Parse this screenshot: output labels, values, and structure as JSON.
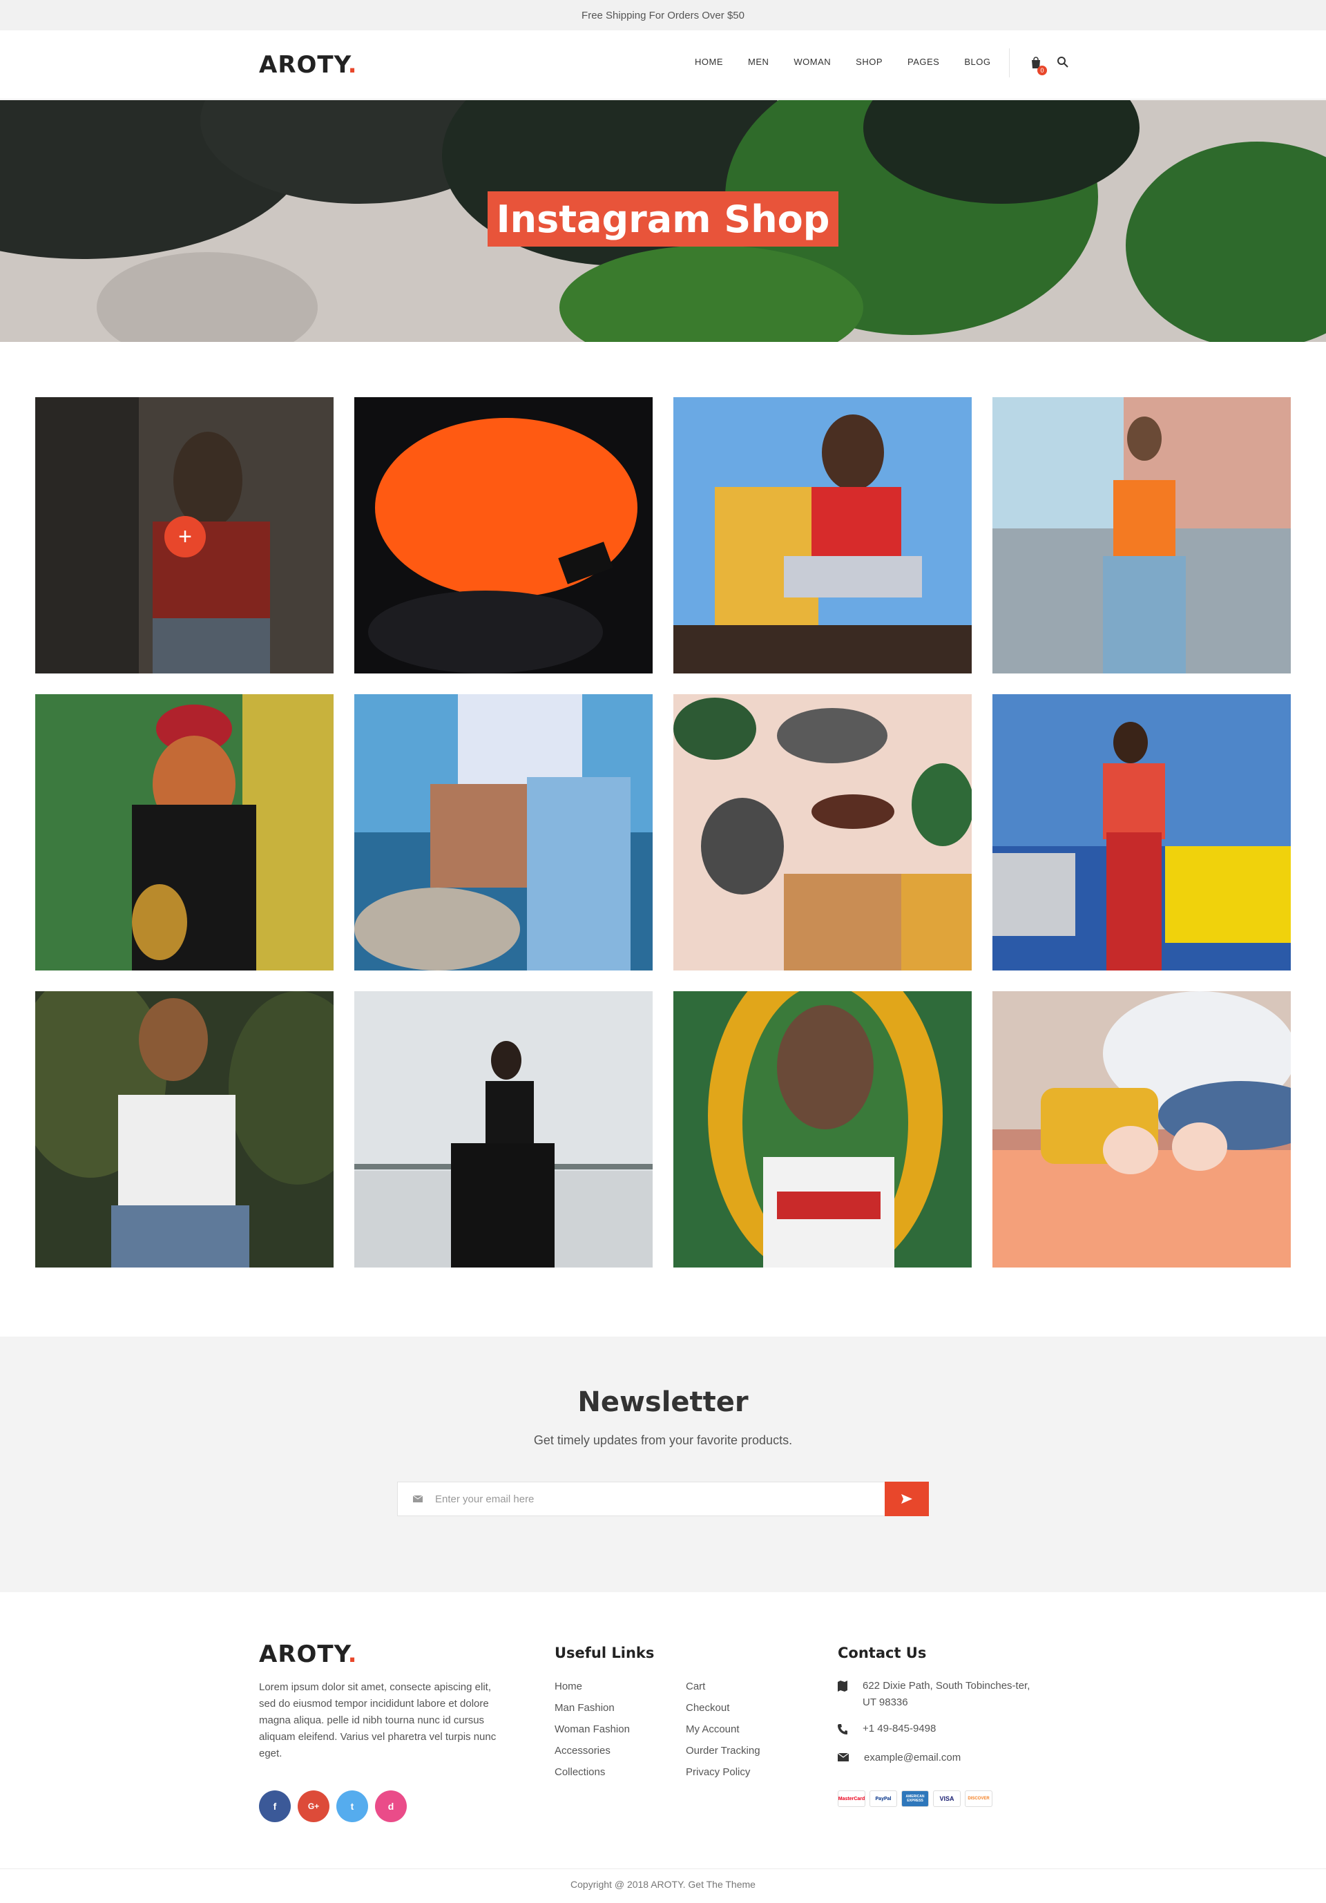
{
  "topbar": {
    "text": "Free Shipping For Orders Over $50"
  },
  "header": {
    "logo_text": "AROTY",
    "logo_dot": ".",
    "nav": [
      "HOME",
      "MEN",
      "WOMAN",
      "SHOP",
      "PAGES",
      "BLOG"
    ],
    "cart_count": "0",
    "icons": {
      "cart": "shopping-bag-icon",
      "search": "search-icon"
    }
  },
  "hero": {
    "title": "Instagram Shop"
  },
  "grid": {
    "hover_plus": "+",
    "tiles": [
      "woman-red-tshirt",
      "orange-beanie",
      "woman-red-top-sitting",
      "woman-orange-tee-rooftop",
      "woman-red-cap-pineapple",
      "leather-handbag-sea",
      "sneakers-sunglasses-flatlay",
      "woman-colorful-yellow-car",
      "laughing-woman-leaves",
      "woman-black-jumpsuit",
      "woman-levis-sunglasses",
      "yellow-case-sunglasses"
    ]
  },
  "newsletter": {
    "title": "Newsletter",
    "subtitle": "Get timely updates from your favorite products.",
    "placeholder": "Enter your email here"
  },
  "footer": {
    "logo_text": "AROTY",
    "logo_dot": ".",
    "about": "Lorem ipsum dolor sit amet, consecte apiscing elit, sed do eiusmod tempor incididunt  labore et dolore magna aliqua. pelle id nibh tourna nunc id cursus aliquam eleifend. Varius vel pharetra vel turpis nunc eget.",
    "socials": [
      "f",
      "G+",
      "t",
      "d"
    ],
    "useful_links_title": "Useful Links",
    "links_col1": [
      "Home",
      "Man Fashion",
      "Woman Fashion",
      "Accessories",
      "Collections"
    ],
    "links_col2": [
      "Cart",
      "Checkout",
      "My Account",
      "Ourder Tracking",
      "Privacy Policy"
    ],
    "contact_title": "Contact Us",
    "address": "622 Dixie Path, South Tobinches-ter, UT 98336",
    "phone": "+1 49-845-9498",
    "email": "example@email.com",
    "payments": [
      "MasterCard",
      "PayPal",
      "AMERICAN EXPRESS",
      "VISA",
      "DISCOVER"
    ],
    "copyright": "Copyright @ 2018 AROTY. Get The Theme"
  },
  "colors": {
    "accent": "#e8472b",
    "hero_title_bg": "#e8543a"
  }
}
